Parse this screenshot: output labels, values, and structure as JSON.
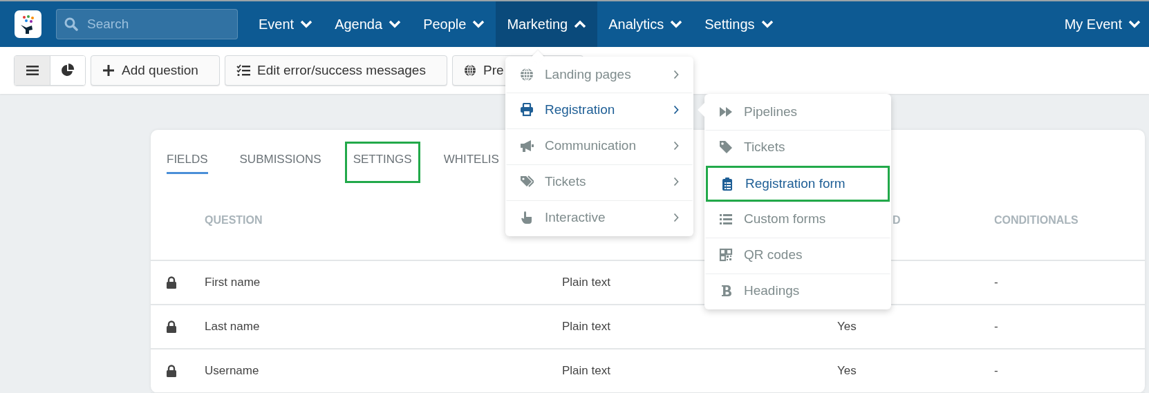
{
  "topbar": {
    "search": {
      "placeholder": "Search"
    },
    "nav": [
      {
        "label": "Event",
        "expanded": false
      },
      {
        "label": "Agenda",
        "expanded": false
      },
      {
        "label": "People",
        "expanded": false
      },
      {
        "label": "Marketing",
        "expanded": true
      },
      {
        "label": "Analytics",
        "expanded": false
      },
      {
        "label": "Settings",
        "expanded": false
      }
    ],
    "account": {
      "label": "My Event",
      "expanded": false
    }
  },
  "toolbar": {
    "view_toggle": [
      {
        "selected": true
      },
      {
        "selected": false
      }
    ],
    "buttons": [
      {
        "label": "Add question"
      },
      {
        "label": "Edit error/success messages"
      },
      {
        "label": "Pre"
      }
    ]
  },
  "tabs": [
    {
      "label": "FIELDS",
      "selected": true,
      "highlighted": false
    },
    {
      "label": "SUBMISSIONS",
      "selected": false,
      "highlighted": false
    },
    {
      "label": "SETTINGS",
      "selected": false,
      "highlighted": true
    },
    {
      "label": "WHITELIS",
      "selected": false,
      "highlighted": false
    }
  ],
  "table": {
    "columns": [
      {
        "label": "QUESTION"
      },
      {
        "label": "D"
      },
      {
        "label": "CONDITIONALS"
      }
    ],
    "rows": [
      {
        "locked": true,
        "question": "First name",
        "type": "Plain text",
        "conditionals": "-"
      },
      {
        "locked": true,
        "question": "Last name",
        "type": "Plain text",
        "required": "Yes",
        "conditionals": "-"
      },
      {
        "locked": true,
        "question": "Username",
        "type": "Plain text",
        "required": "Yes",
        "conditionals": "-"
      }
    ]
  },
  "menu": {
    "items": [
      {
        "label": "Landing pages",
        "selected": false
      },
      {
        "label": "Registration",
        "selected": true
      },
      {
        "label": "Communication",
        "selected": false
      },
      {
        "label": "Tickets",
        "selected": false
      },
      {
        "label": "Interactive",
        "selected": false
      }
    ]
  },
  "submenu": {
    "items": [
      {
        "label": "Pipelines",
        "selected": false,
        "highlighted": false
      },
      {
        "label": "Tickets",
        "selected": false,
        "highlighted": false
      },
      {
        "label": "Registration form",
        "selected": true,
        "highlighted": true
      },
      {
        "label": "Custom forms",
        "selected": false,
        "highlighted": false
      },
      {
        "label": "QR codes",
        "selected": false,
        "highlighted": false
      },
      {
        "label": "Headings",
        "selected": false,
        "highlighted": false
      }
    ]
  }
}
